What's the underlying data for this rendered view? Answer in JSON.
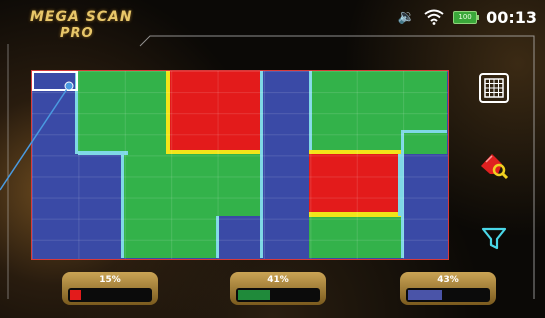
{
  "app": {
    "logo_line1": "MEGA SCAN",
    "logo_line2": "PRO"
  },
  "status_bar": {
    "volume_icon": "speaker-icon",
    "wifi_icon": "wifi-icon",
    "battery_label": "100",
    "time": "00:13"
  },
  "colors": {
    "blue": "#3a4aa6",
    "green": "#33b24a",
    "red": "#e31b1b",
    "yellow": "#f2e51a",
    "cyan": "#7fd8e6",
    "border": "#d63a3a",
    "gold": "#caa455"
  },
  "scan_map": {
    "cols": 9,
    "rows": 9,
    "cells": [
      "BGGRRBGGG",
      "BGGRRBGGG",
      "BGGRRBGGG",
      "BGGRRBGGG",
      "BBGGGBRRB",
      "BBGGGBRRB",
      "BBGGGBRRB",
      "BBGGBBGGB",
      "BBGGBBGGB"
    ]
  },
  "side_tools": [
    {
      "icon": "grid-view-icon"
    },
    {
      "icon": "scan-search-icon"
    },
    {
      "icon": "filter-icon"
    }
  ],
  "legend": [
    {
      "label": "15%",
      "value": 0.15,
      "color": "#e31b1b"
    },
    {
      "label": "41%",
      "value": 0.41,
      "color": "#1f8a3a"
    },
    {
      "label": "43%",
      "value": 0.43,
      "color": "#4a54a8"
    }
  ]
}
